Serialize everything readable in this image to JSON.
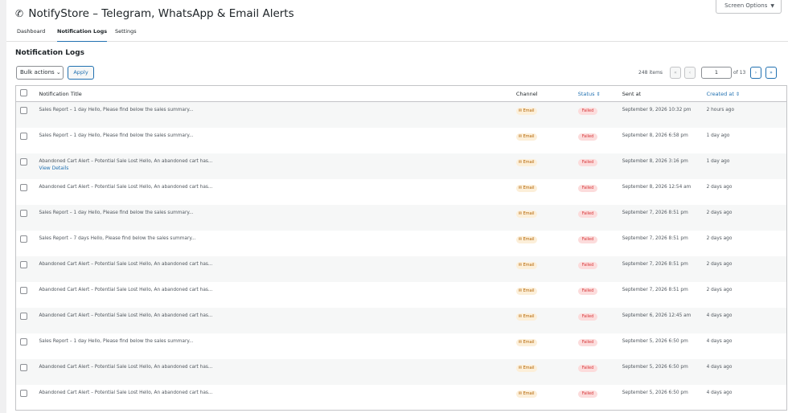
{
  "screen_options": {
    "label": "Screen Options",
    "arrow": "▼"
  },
  "app": {
    "title": "NotifyStore – Telegram, WhatsApp & Email Alerts",
    "logo_glyph": "✆"
  },
  "tabs": [
    {
      "label": "Dashboard",
      "active": false
    },
    {
      "label": "Notification Logs",
      "active": true
    },
    {
      "label": "Settings",
      "active": false
    }
  ],
  "section": {
    "title": "Notification Logs"
  },
  "toolbar": {
    "bulk_label": "Bulk actions",
    "bulk_arrow": "⌄",
    "apply_label": "Apply"
  },
  "pagination": {
    "count": "248 items",
    "first": "«",
    "prev": "‹",
    "current": "1",
    "of": "of 13",
    "next": "›",
    "last": "»"
  },
  "table": {
    "headers": {
      "title": "Notification Title",
      "channel": "Channel",
      "status": "Status",
      "sent_at": "Sent at",
      "created_at": "Created at",
      "sort_icon": "⇕"
    },
    "view_details": "View Details",
    "rows": [
      {
        "title": "Sales Report – 1 day Hello, Please find below the sales summary...",
        "channel": "✉ Email",
        "status": "Failed",
        "sent_at": "September 9, 2026 10:32 pm",
        "created_at": "2 hours ago"
      },
      {
        "title": "Sales Report – 1 day Hello, Please find below the sales summary...",
        "channel": "✉ Email",
        "status": "Failed",
        "sent_at": "September 8, 2026 6:58 pm",
        "created_at": "1 day ago"
      },
      {
        "title": "Abandoned Cart Alert – Potential Sale Lost Hello, An abandoned cart has...",
        "channel": "✉ Email",
        "status": "Failed",
        "sent_at": "September 8, 2026 3:16 pm",
        "created_at": "1 day ago"
      },
      {
        "title": "Abandoned Cart Alert – Potential Sale Lost Hello, An abandoned cart has...",
        "channel": "✉ Email",
        "status": "Failed",
        "sent_at": "September 8, 2026 12:54 am",
        "created_at": "2 days ago"
      },
      {
        "title": "Sales Report – 1 day Hello, Please find below the sales summary...",
        "channel": "✉ Email",
        "status": "Failed",
        "sent_at": "September 7, 2026 8:51 pm",
        "created_at": "2 days ago"
      },
      {
        "title": "Sales Report – 7 days Hello, Please find below the sales summary...",
        "channel": "✉ Email",
        "status": "Failed",
        "sent_at": "September 7, 2026 8:51 pm",
        "created_at": "2 days ago"
      },
      {
        "title": "Abandoned Cart Alert – Potential Sale Lost Hello, An abandoned cart has...",
        "channel": "✉ Email",
        "status": "Failed",
        "sent_at": "September 7, 2026 8:51 pm",
        "created_at": "2 days ago"
      },
      {
        "title": "Abandoned Cart Alert – Potential Sale Lost Hello, An abandoned cart has...",
        "channel": "✉ Email",
        "status": "Failed",
        "sent_at": "September 7, 2026 8:51 pm",
        "created_at": "2 days ago"
      },
      {
        "title": "Abandoned Cart Alert – Potential Sale Lost Hello, An abandoned cart has...",
        "channel": "✉ Email",
        "status": "Failed",
        "sent_at": "September 6, 2026 12:45 am",
        "created_at": "4 days ago"
      },
      {
        "title": "Sales Report – 1 day Hello, Please find below the sales summary...",
        "channel": "✉ Email",
        "status": "Failed",
        "sent_at": "September 5, 2026 6:50 pm",
        "created_at": "4 days ago"
      },
      {
        "title": "Abandoned Cart Alert – Potential Sale Lost Hello, An abandoned cart has...",
        "channel": "✉ Email",
        "status": "Failed",
        "sent_at": "September 5, 2026 6:50 pm",
        "created_at": "4 days ago"
      },
      {
        "title": "Abandoned Cart Alert – Potential Sale Lost Hello, An abandoned cart has...",
        "channel": "✉ Email",
        "status": "Failed",
        "sent_at": "September 5, 2026 6:50 pm",
        "created_at": "4 days ago"
      }
    ]
  }
}
